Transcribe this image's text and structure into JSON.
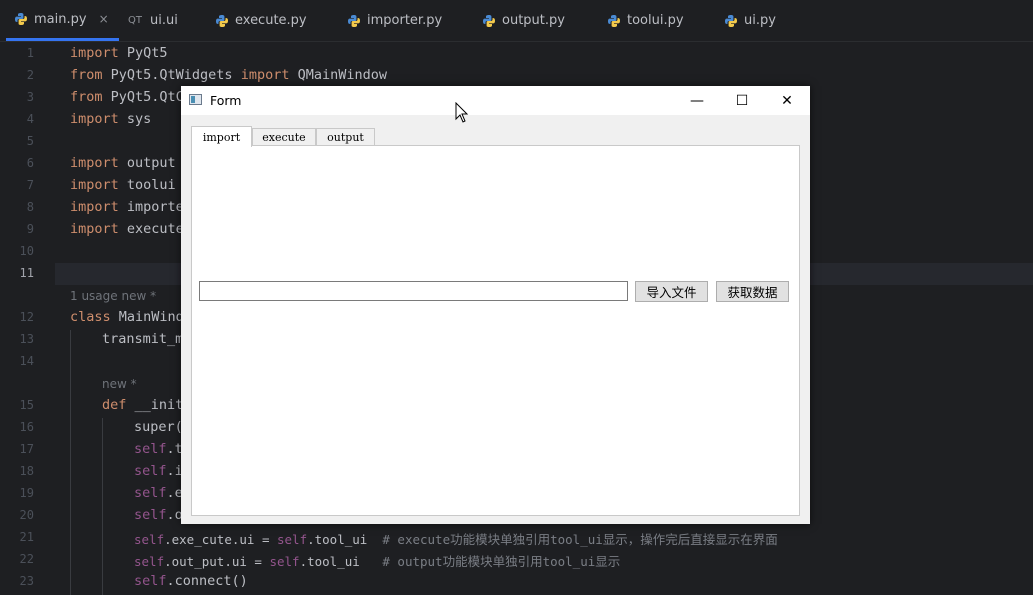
{
  "editor_tabs": [
    {
      "label": "main.py",
      "icon": "python-icon",
      "active": true,
      "close": "×"
    },
    {
      "label": "ui.ui",
      "icon": "qt-icon",
      "icon_text": "QT"
    },
    {
      "label": "execute.py",
      "icon": "python-icon"
    },
    {
      "label": "importer.py",
      "icon": "python-icon"
    },
    {
      "label": "output.py",
      "icon": "python-icon"
    },
    {
      "label": "toolui.py",
      "icon": "python-icon"
    },
    {
      "label": "ui.py",
      "icon": "python-icon"
    }
  ],
  "line_numbers": [
    "1",
    "2",
    "3",
    "4",
    "5",
    "6",
    "7",
    "8",
    "9",
    "10",
    "11",
    "12",
    "13",
    "14",
    "15",
    "16",
    "17",
    "18",
    "19",
    "20",
    "21",
    "22",
    "23"
  ],
  "hints": {
    "usage": "1 usage   new *",
    "new": "new *"
  },
  "code": {
    "l1_kw": "import",
    "l1_rest": " PyQt5",
    "l2_kw1": "from",
    "l2_mid": " PyQt5.QtWidgets ",
    "l2_kw2": "import",
    "l2_rest": " QMainWindow",
    "l3_kw": "from",
    "l3_rest": " PyQt5.QtC",
    "l4_kw": "import",
    "l4_rest": " sys",
    "l6_kw": "import",
    "l6_rest": " output",
    "l7_kw": "import",
    "l7_rest": " toolui",
    "l8_kw": "import",
    "l8_rest": " importe",
    "l9_kw": "import",
    "l9_rest": " execute",
    "l12_kw": "class",
    "l12_rest": " MainWind",
    "l13_rest": "transmit_m",
    "l15_kw": "def",
    "l15_rest": " __init",
    "l16_rest": "super(",
    "l17_self": "self",
    "l17_rest": ".t",
    "l18_self": "self",
    "l18_rest": ".i",
    "l19_self": "self",
    "l19_rest": ".e",
    "l20_self": "self",
    "l20_rest": ".o",
    "l21_self": "self",
    "l21_mid": ".exe_cute.ui = ",
    "l21_self2": "self",
    "l21_rest": ".tool_ui  ",
    "l21_comment": "# execute功能模块单独引用tool_ui显示，操作完后直接显示在界面",
    "l22_self": "self",
    "l22_mid": ".out_put.ui = ",
    "l22_self2": "self",
    "l22_rest": ".tool_ui   ",
    "l22_comment": "# output功能模块单独引用tool_ui显示",
    "l23_self": "self",
    "l23_rest": ".connect()"
  },
  "qt_window": {
    "title": "Form",
    "controls": {
      "minimize": "—",
      "maximize": "☐",
      "close": "✕"
    },
    "tabs": [
      "import",
      "execute",
      "output"
    ],
    "selected_tab": "import",
    "file_path_value": "",
    "import_button": "导入文件",
    "fetch_button": "获取数据"
  },
  "colors": {
    "editor_bg": "#1e1f22",
    "keyword": "#cf8e6d",
    "self": "#94558d",
    "comment": "#7a7e85",
    "accent": "#3574f0"
  }
}
